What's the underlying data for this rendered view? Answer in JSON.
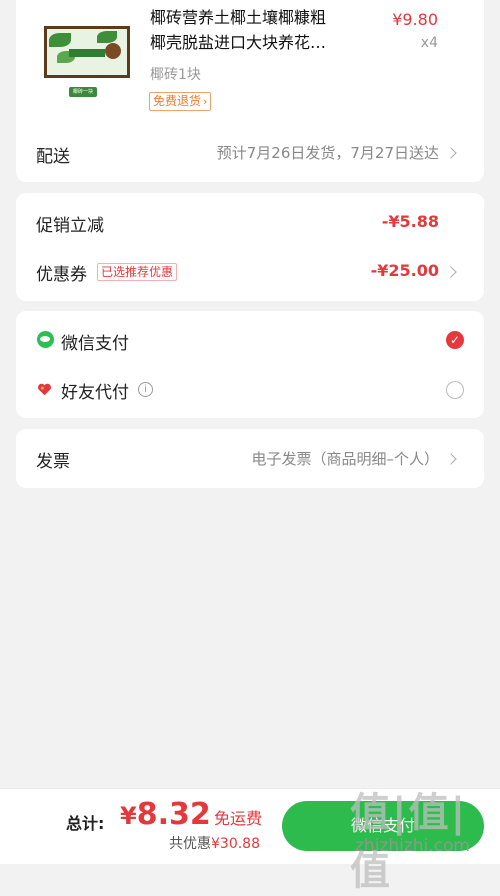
{
  "product": {
    "name_line1": "椰砖营养土椰土壤椰糠粗",
    "name_line2": "椰壳脱盐进口大块养花…",
    "price": "¥9.80",
    "quantity": "x4",
    "spec": "椰砖1块",
    "return_tag": "免费退货",
    "thumb_caption": "椰砖一块"
  },
  "delivery": {
    "label": "配送",
    "value": "预计7月26日发货，7月27日送达"
  },
  "promotion": {
    "label": "促销立减",
    "value": "-¥5.88"
  },
  "coupon": {
    "label": "优惠券",
    "tag": "已选推荐优惠",
    "value": "-¥25.00"
  },
  "payment": {
    "wechat_label": "微信支付",
    "friend_label": "好友代付",
    "wechat_color": "#2cc052",
    "selected_color": "#e4393c"
  },
  "invoice": {
    "label": "发票",
    "value": "电子发票（商品明细–个人）"
  },
  "footer": {
    "total_label": "总计:",
    "currency": "¥",
    "total_amount": "8.32",
    "free_shipping": "免运费",
    "saved_label": "共优惠",
    "saved_amount": "¥30.88",
    "pay_button": "微信支付",
    "button_color": "#2dbb4e"
  },
  "watermark": {
    "chars": "值|值|值",
    "url": "zhizhizhi.com"
  }
}
